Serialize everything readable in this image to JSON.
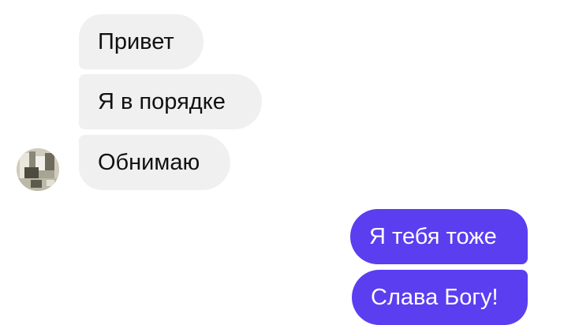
{
  "conversation": {
    "incoming": [
      {
        "text": "Привет"
      },
      {
        "text": "Я в порядке"
      },
      {
        "text": "Обнимаю"
      }
    ],
    "outgoing": [
      {
        "text": "Я тебя тоже"
      },
      {
        "text": "Слава Богу!"
      }
    ]
  },
  "colors": {
    "incoming_bubble": "#f0f0f0",
    "outgoing_bubble": "#5b3ef0",
    "incoming_text": "#111111",
    "outgoing_text": "#ffffff"
  },
  "icons": {
    "contact_avatar": "avatar-photo"
  }
}
